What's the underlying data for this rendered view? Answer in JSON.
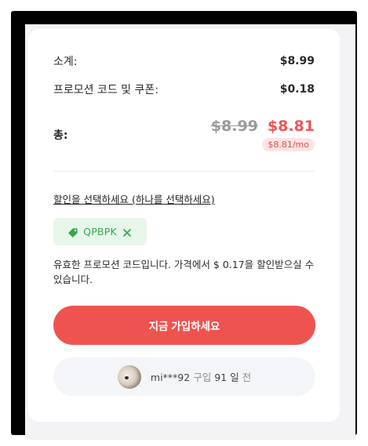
{
  "summary": {
    "subtotal_label": "소계:",
    "subtotal_value": "$8.99",
    "promo_label": "프로모션 코드 및 쿠폰:",
    "promo_value": "$0.18",
    "total_label": "총:",
    "total_old": "$8.99",
    "total_new": "$8.81",
    "per_month": "$8.81/mo"
  },
  "discount": {
    "select_link": "할인을 선택하세요 (하나를 선택하세요)",
    "coupon_code": "QPBPK",
    "coupon_icon": "tag-icon",
    "remove_icon": "close-icon",
    "valid_message": "유효한 프로모션 코드입니다. 가격에서 $ 0.17을 할인받으실 수 있습니다."
  },
  "cta": {
    "signup_label": "지금 가입하세요"
  },
  "social_proof": {
    "user": "mi***92",
    "purchase_word": "구입",
    "days": "91",
    "day_unit": "일",
    "ago": "전"
  },
  "colors": {
    "accent_red": "#ef5350",
    "green": "#34a853"
  }
}
